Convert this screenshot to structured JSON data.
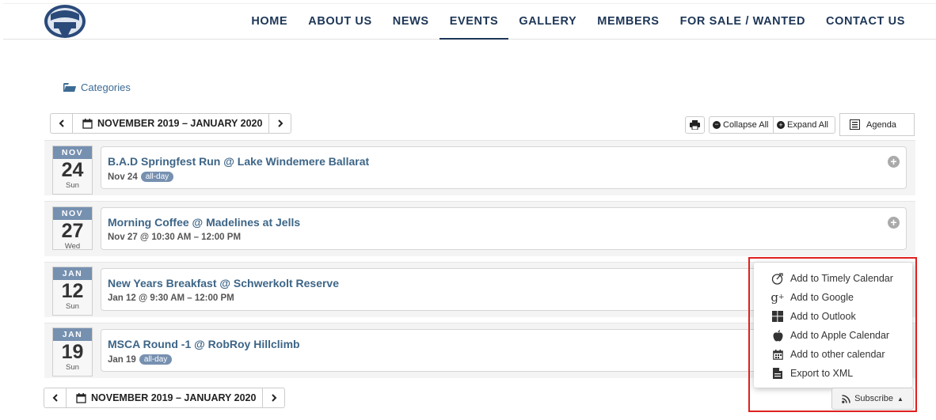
{
  "nav": [
    "HOME",
    "ABOUT US",
    "NEWS",
    "EVENTS",
    "GALLERY",
    "MEMBERS",
    "FOR SALE / WANTED",
    "CONTACT US"
  ],
  "nav_active": "EVENTS",
  "categories_label": "Categories",
  "date_range": "NOVEMBER 2019 – JANUARY 2020",
  "toolbar": {
    "collapse_all": "Collapse All",
    "expand_all": "Expand All",
    "agenda": "Agenda"
  },
  "events": [
    {
      "month": "NOV",
      "day": "24",
      "weekday": "Sun",
      "title": "B.A.D Springfest Run @ Lake Windemere Ballarat",
      "time": "Nov 24",
      "badge": "all-day"
    },
    {
      "month": "NOV",
      "day": "27",
      "weekday": "Wed",
      "title": "Morning Coffee @ Madelines at Jells",
      "time": "Nov 27 @ 10:30 AM – 12:00 PM",
      "badge": ""
    },
    {
      "month": "JAN",
      "day": "12",
      "weekday": "Sun",
      "title": "New Years Breakfast @ Schwerkolt Reserve",
      "time": "Jan 12 @ 9:30 AM – 12:00 PM",
      "badge": ""
    },
    {
      "month": "JAN",
      "day": "19",
      "weekday": "Sun",
      "title": "MSCA Round -1 @ RobRoy Hillclimb",
      "time": "Jan 19",
      "badge": "all-day"
    }
  ],
  "subscribe_menu": [
    {
      "label": "Add to Timely Calendar",
      "icon": "timely-icon"
    },
    {
      "label": "Add to Google",
      "icon": "google-plus-icon"
    },
    {
      "label": "Add to Outlook",
      "icon": "windows-icon"
    },
    {
      "label": "Add to Apple Calendar",
      "icon": "apple-icon"
    },
    {
      "label": "Add to other calendar",
      "icon": "calendar-icon"
    },
    {
      "label": "Export to XML",
      "icon": "file-icon"
    }
  ],
  "subscribe_label": "Subscribe",
  "colors": {
    "nav": "#1d3656",
    "link": "#3d6587",
    "date_header": "#7690b0",
    "highlight": "#e02020"
  }
}
